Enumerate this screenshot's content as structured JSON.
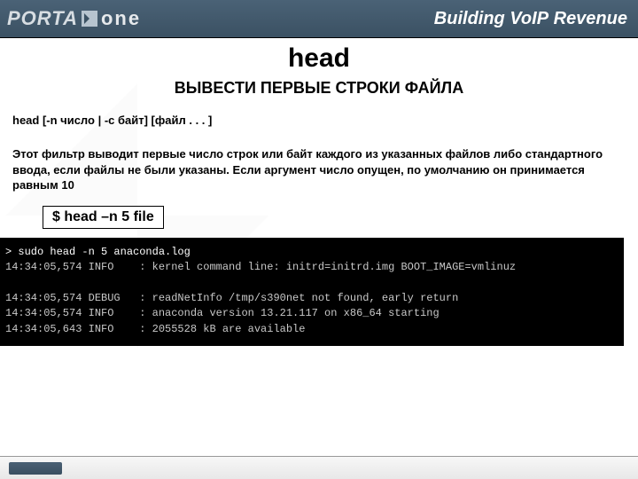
{
  "header": {
    "logo_part1": "PORTA",
    "logo_part2": "one",
    "tagline_prefix": "Building Vo",
    "tagline_ip": "IP",
    "tagline_suffix": " Revenue"
  },
  "title": "head",
  "subtitle": "ВЫВЕСТИ ПЕРВЫЕ СТРОКИ ФАЙЛА",
  "syntax": "head [-n число | -c байт] [файл . . . ]",
  "description": "Этот фильтр выводит первые число строк или байт каждого из указанных файлов либо стандартного ввода, если файлы не были указаны.  Если аргумент число опущен, по умолчанию он принимается равным 10",
  "example": "$ head –n 5 file",
  "terminal": {
    "line1": "> sudo head -n 5 anaconda.log",
    "line2": "14:34:05,574 INFO    : kernel command line: initrd=initrd.img BOOT_IMAGE=vmlinuz",
    "line3": "",
    "line4": "14:34:05,574 DEBUG   : readNetInfo /tmp/s390net not found, early return",
    "line5": "14:34:05,574 INFO    : anaconda version 13.21.117 on x86_64 starting",
    "line6": "14:34:05,643 INFO    : 2055528 kB are available"
  }
}
